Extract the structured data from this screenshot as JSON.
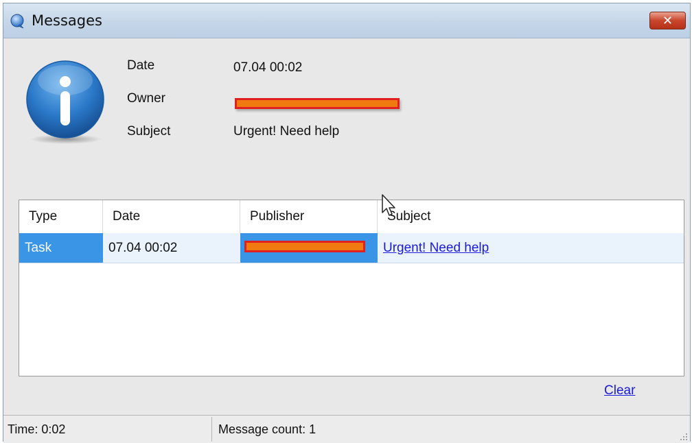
{
  "window": {
    "title": "Messages",
    "close_label": "✕"
  },
  "details": {
    "date_label": "Date",
    "date_value": "07.04 00:02",
    "owner_label": "Owner",
    "subject_label": "Subject",
    "subject_value": "Urgent! Need help"
  },
  "table": {
    "columns": [
      "Type",
      "Date",
      "Publisher",
      "Subject"
    ],
    "rows": [
      {
        "type": "Task",
        "date": "07.04 00:02",
        "subject": "Urgent! Need help"
      }
    ]
  },
  "actions": {
    "clear_label": "Clear"
  },
  "status": {
    "time": "Time: 0:02",
    "count": "Message count: 1"
  },
  "colors": {
    "selection": "#3a95e6",
    "redaction_fill": "#f07a10",
    "redaction_border": "#e02020",
    "link": "#1a1adc"
  },
  "icons": {
    "title": "chat-bubble-icon",
    "info": "info-icon",
    "close": "close-icon",
    "grip": "resize-grip-icon"
  }
}
